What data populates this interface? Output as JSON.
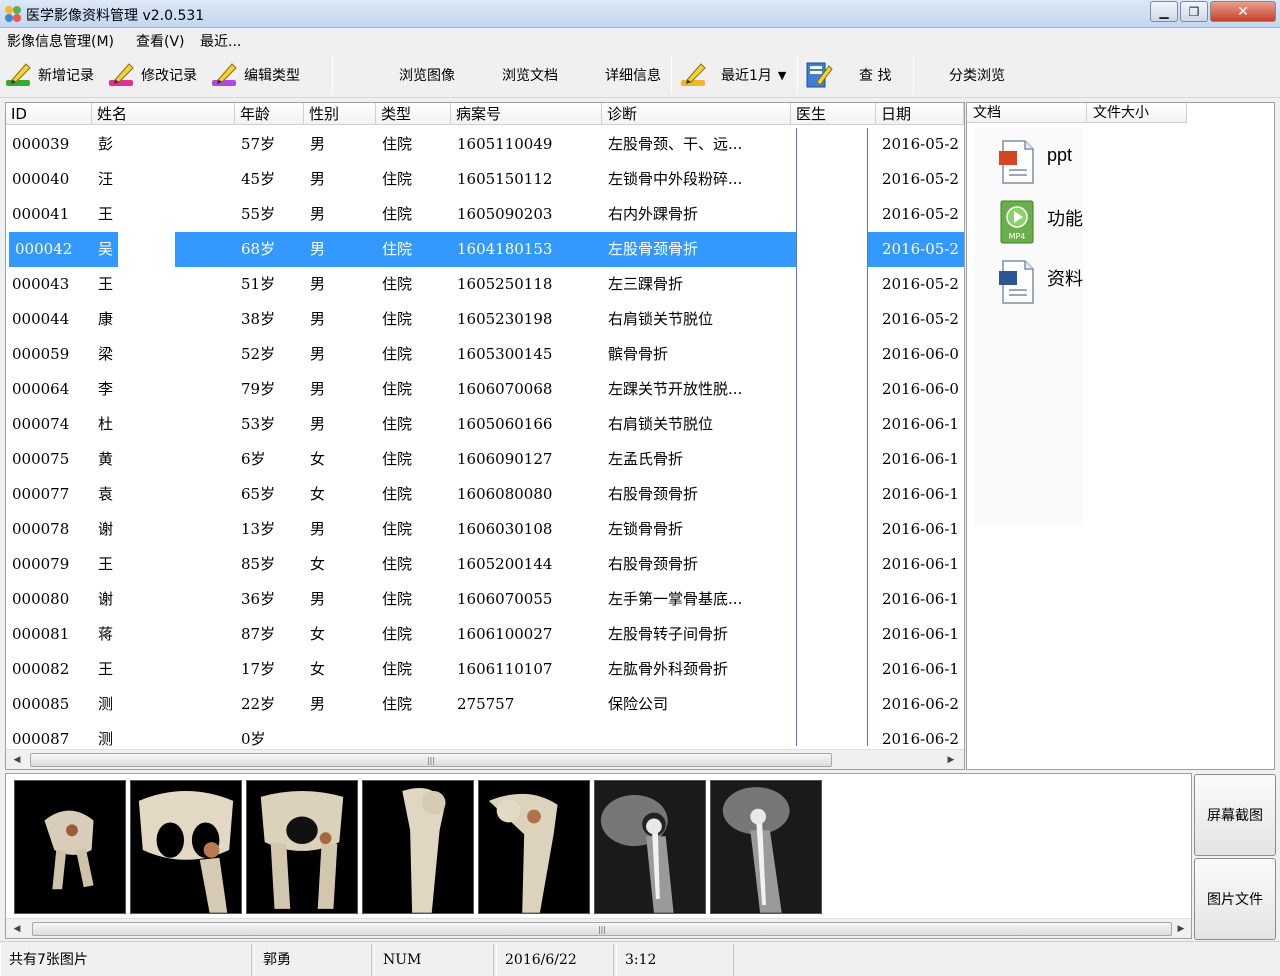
{
  "window": {
    "title": "医学影像资料管理 v2.0.531",
    "min_glyph": "▁",
    "max_glyph": "❐",
    "close_glyph": "✕"
  },
  "menu": {
    "items": [
      "影像信息管理(M)",
      "查看(V)",
      "最近..."
    ]
  },
  "toolbar": {
    "new_record": "新增记录",
    "edit_record": "修改记录",
    "edit_type": "编辑类型",
    "browse_images": "浏览图像",
    "browse_docs": "浏览文档",
    "details": "详细信息",
    "recent": "最近1月",
    "recent_arrow": "▼",
    "search": "查 找",
    "category_browse": "分类浏览"
  },
  "table": {
    "headers": [
      "ID",
      "姓名",
      "年龄",
      "性别",
      "类型",
      "病案号",
      "诊断",
      "医生",
      "日期"
    ],
    "selected_index": 3,
    "rows": [
      [
        "000039",
        "彭",
        "57岁",
        "男",
        "住院",
        "1605110049",
        "左股骨颈、干、远...",
        "",
        "2016-05-2"
      ],
      [
        "000040",
        "汪",
        "45岁",
        "男",
        "住院",
        "1605150112",
        "左锁骨中外段粉碎...",
        "",
        "2016-05-2"
      ],
      [
        "000041",
        "王",
        "55岁",
        "男",
        "住院",
        "1605090203",
        "右内外踝骨折",
        "",
        "2016-05-2"
      ],
      [
        "000042",
        "吴",
        "68岁",
        "男",
        "住院",
        "1604180153",
        "左股骨颈骨折",
        "",
        "2016-05-2"
      ],
      [
        "000043",
        "王",
        "51岁",
        "男",
        "住院",
        "1605250118",
        "左三踝骨折",
        "",
        "2016-05-2"
      ],
      [
        "000044",
        "康",
        "38岁",
        "男",
        "住院",
        "1605230198",
        "右肩锁关节脱位",
        "",
        "2016-05-2"
      ],
      [
        "000059",
        "梁",
        "52岁",
        "男",
        "住院",
        "1605300145",
        "髌骨骨折",
        "",
        "2016-06-0"
      ],
      [
        "000064",
        "李",
        "79岁",
        "男",
        "住院",
        "1606070068",
        "左踝关节开放性脱...",
        "",
        "2016-06-0"
      ],
      [
        "000074",
        "杜",
        "53岁",
        "男",
        "住院",
        "1605060166",
        "右肩锁关节脱位",
        "",
        "2016-06-1"
      ],
      [
        "000075",
        "黄",
        "6岁",
        "女",
        "住院",
        "1606090127",
        "左孟氏骨折",
        "",
        "2016-06-1"
      ],
      [
        "000077",
        "袁",
        "65岁",
        "女",
        "住院",
        "1606080080",
        "右股骨颈骨折",
        "",
        "2016-06-1"
      ],
      [
        "000078",
        "谢",
        "13岁",
        "男",
        "住院",
        "1606030108",
        "左锁骨骨折",
        "",
        "2016-06-1"
      ],
      [
        "000079",
        "王",
        "85岁",
        "女",
        "住院",
        "1605200144",
        "右股骨颈骨折",
        "",
        "2016-06-1"
      ],
      [
        "000080",
        "谢",
        "36岁",
        "男",
        "住院",
        "1606070055",
        "左手第一掌骨基底...",
        "",
        "2016-06-1"
      ],
      [
        "000081",
        "蒋",
        "87岁",
        "女",
        "住院",
        "1606100027",
        "左股骨转子间骨折",
        "",
        "2016-06-1"
      ],
      [
        "000082",
        "王",
        "17岁",
        "女",
        "住院",
        "1606110107",
        "左肱骨外科颈骨折",
        "",
        "2016-06-1"
      ],
      [
        "000085",
        "测",
        "22岁",
        "男",
        "住院",
        "275757",
        "保险公司",
        "",
        "2016-06-2"
      ],
      [
        "000087",
        "测",
        "0岁",
        "",
        "",
        "",
        "",
        "",
        "2016-06-2"
      ]
    ],
    "scroll_left": "◀",
    "scroll_right": "▶",
    "grip": "|||"
  },
  "docs": {
    "headers": [
      "文档",
      "文件大小"
    ],
    "items": [
      {
        "label": "ppt",
        "icon": "ppt-file-icon"
      },
      {
        "label": "功能",
        "icon": "mp4-file-icon",
        "badge": "MP4"
      },
      {
        "label": "资料",
        "icon": "word-file-icon"
      }
    ]
  },
  "thumbnails": {
    "count": 7,
    "scroll_left": "◀",
    "scroll_right": "▶",
    "grip": "|||"
  },
  "side_buttons": {
    "screenshot": "屏幕截图",
    "image_file": "图片文件"
  },
  "status": {
    "image_count": "共有7张图片",
    "user": "郭勇",
    "num": "NUM",
    "date": "2016/6/22",
    "time": "3:12"
  },
  "colors": {
    "selection": "#3399ff",
    "divider": "#5b78c6"
  }
}
